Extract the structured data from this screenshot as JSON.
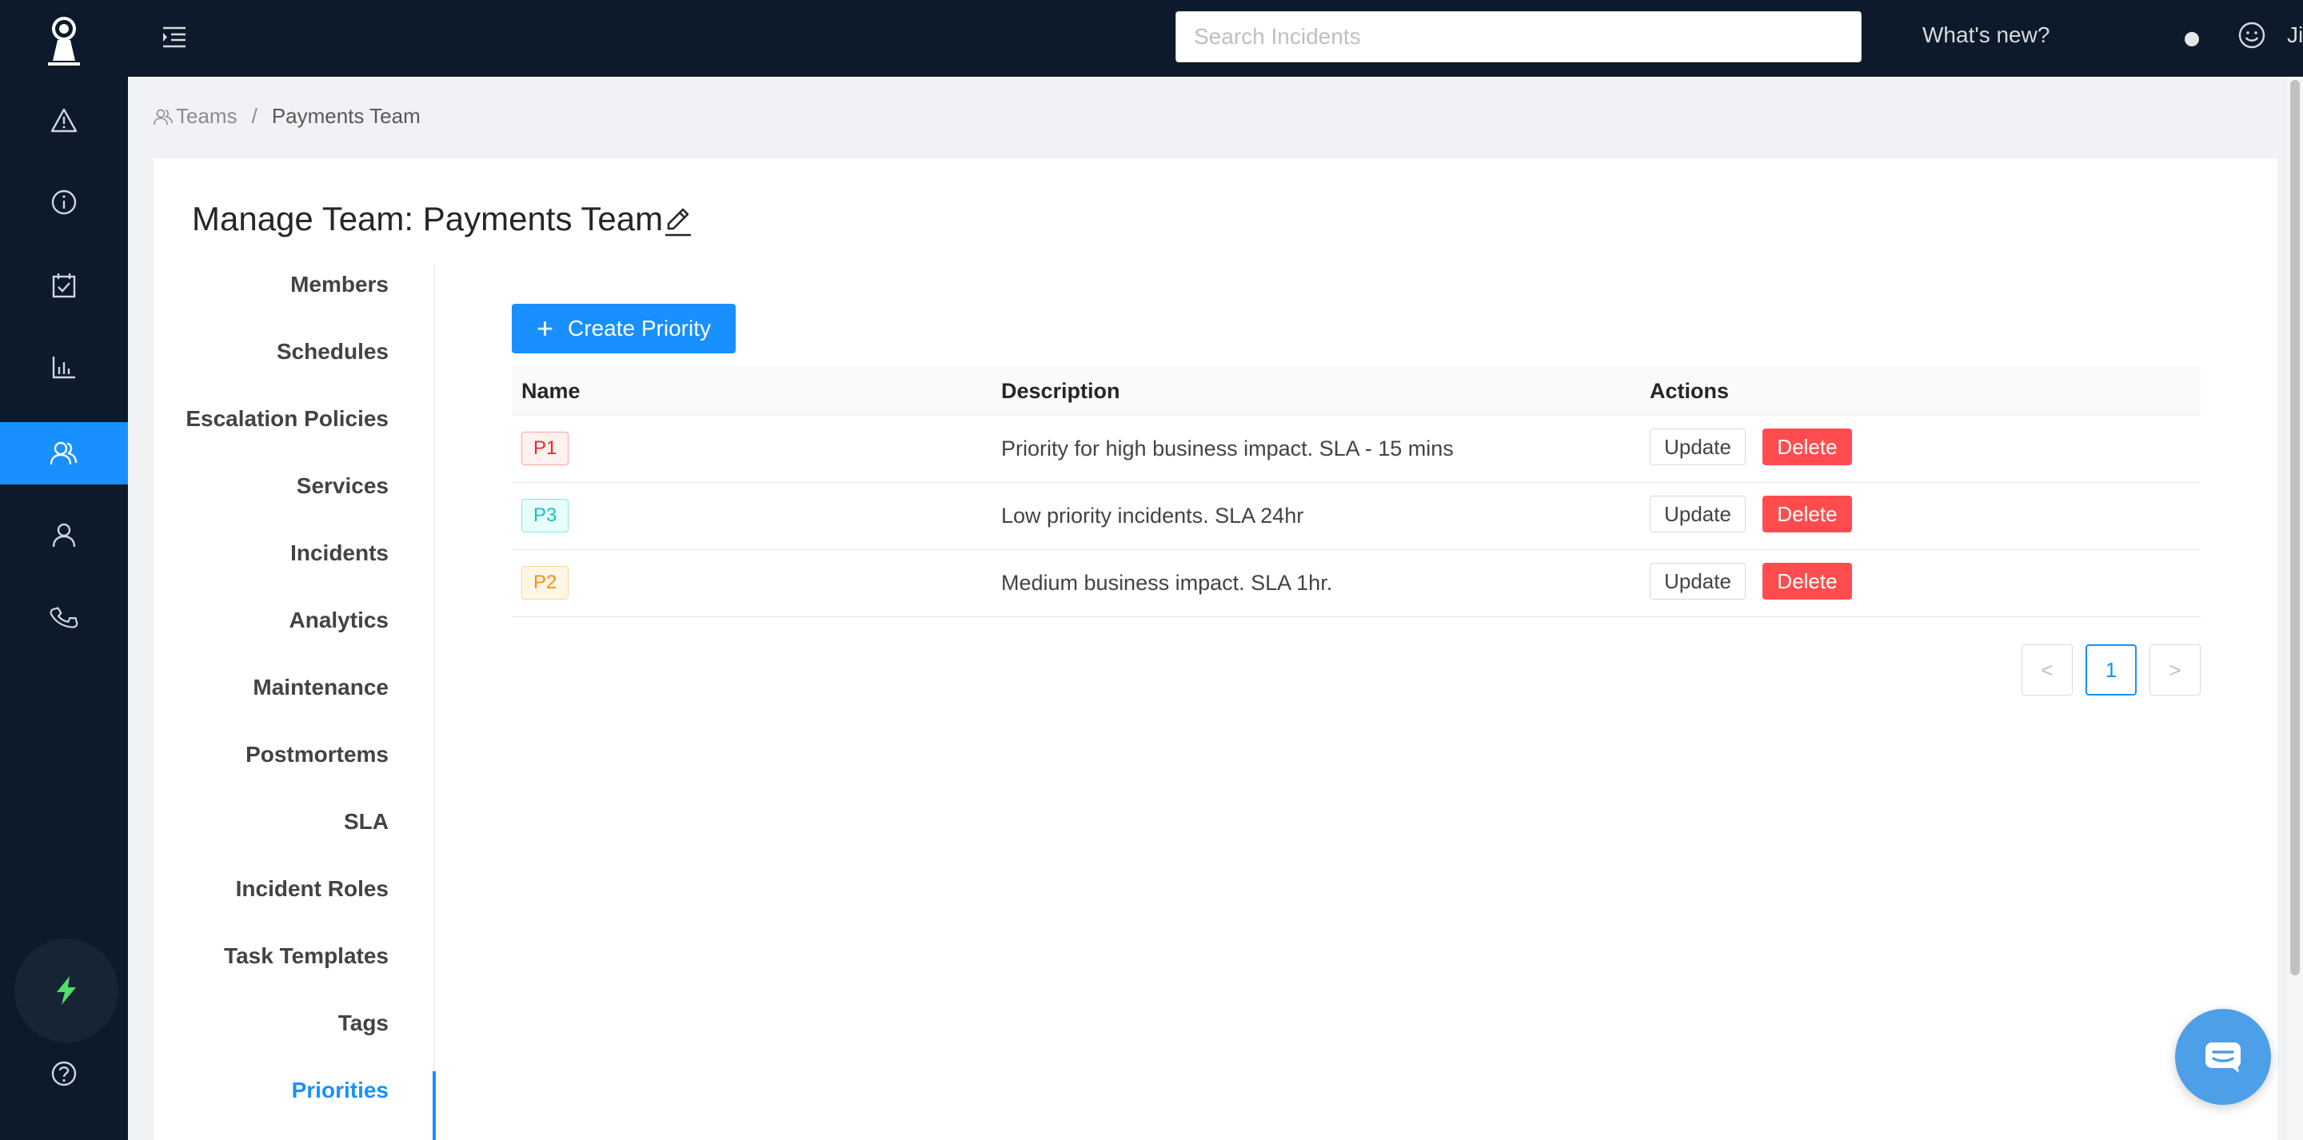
{
  "colors": {
    "rail_bg": "#0c1a2c",
    "accent": "#1890ff",
    "danger": "#ff4d4f"
  },
  "rail": {
    "icons": [
      "alert-triangle-icon",
      "info-icon",
      "calendar-check-icon",
      "bar-chart-icon",
      "teams-icon",
      "user-icon",
      "phone-icon",
      "lightning-icon",
      "help-icon"
    ],
    "active": "teams-icon"
  },
  "topbar": {
    "search_placeholder": "Search Incidents",
    "whats_new": "What's new?",
    "user_name": "Jim Halpert"
  },
  "breadcrumb": {
    "root": "Teams",
    "separator": "/",
    "current": "Payments Team"
  },
  "page": {
    "title": "Manage Team: Payments Team"
  },
  "side_menu": {
    "items": [
      "Members",
      "Schedules",
      "Escalation Policies",
      "Services",
      "Incidents",
      "Analytics",
      "Maintenance",
      "Postmortems",
      "SLA",
      "Incident Roles",
      "Task Templates",
      "Tags",
      "Priorities"
    ],
    "active": "Priorities"
  },
  "priorities": {
    "create_label": "Create Priority",
    "columns": {
      "name": "Name",
      "description": "Description",
      "actions": "Actions"
    },
    "rows": [
      {
        "name": "P1",
        "description": "Priority for high business impact. SLA - 15 mins",
        "color": "#f5222d",
        "bg": "#fff1f0",
        "border": "#ffa39e"
      },
      {
        "name": "P3",
        "description": "Low priority incidents. SLA 24hr",
        "color": "#13c2c2",
        "bg": "#e6fffb",
        "border": "#87e8de"
      },
      {
        "name": "P2",
        "description": "Medium business impact. SLA 1hr.",
        "color": "#fa8c16",
        "bg": "#fff7e6",
        "border": "#ffd591"
      }
    ],
    "update_label": "Update",
    "delete_label": "Delete"
  },
  "pagination": {
    "prev": "<",
    "current": "1",
    "next": ">"
  }
}
